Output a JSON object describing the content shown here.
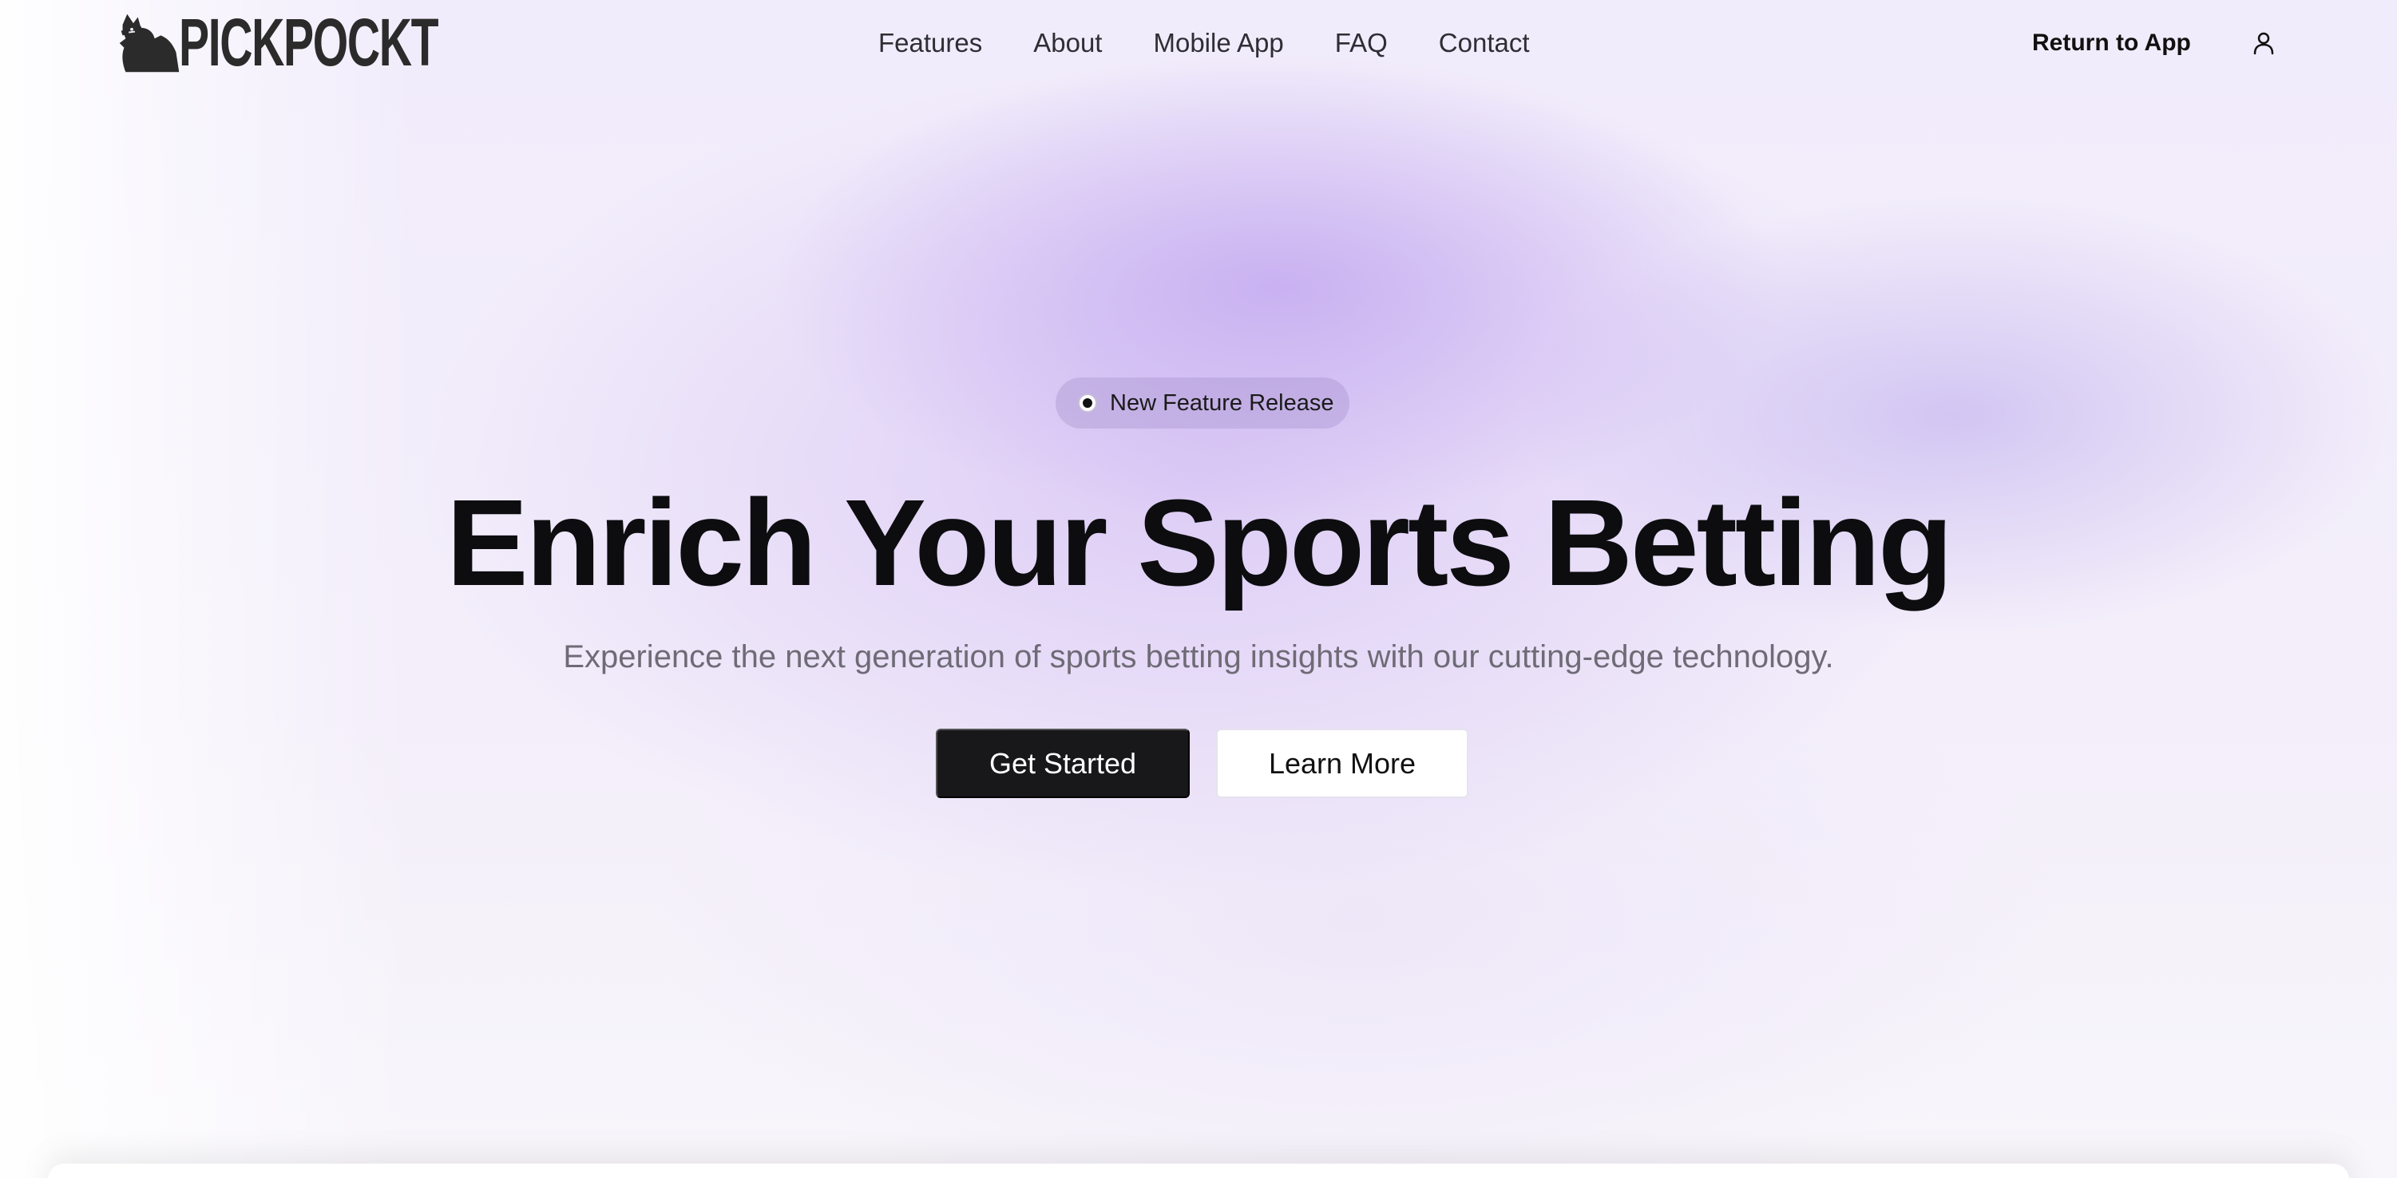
{
  "brand": {
    "name": "PICKPOCKT",
    "logo_icon": "cat-thief-icon"
  },
  "nav": {
    "links": [
      "Features",
      "About",
      "Mobile App",
      "FAQ",
      "Contact"
    ],
    "return_label": "Return to App",
    "user_icon": "user-icon"
  },
  "hero": {
    "badge": "New Feature Release",
    "headline": "Enrich Your Sports Betting",
    "subheadline": "Experience the next generation of sports betting insights with our cutting-edge technology.",
    "primary_cta": "Get Started",
    "secondary_cta": "Learn More"
  },
  "colors": {
    "accent_gradient": "#d4c2f4",
    "primary_button": "#18181b",
    "text_dark": "#0d0d10",
    "text_muted": "#6f6b76"
  }
}
